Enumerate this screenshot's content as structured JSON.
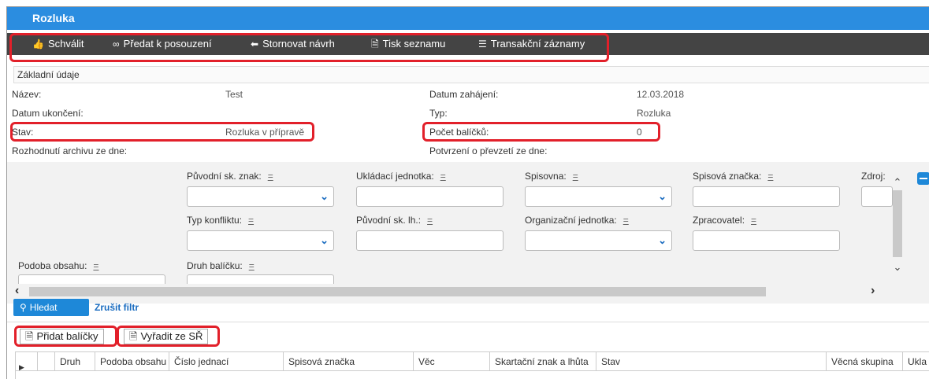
{
  "window": {
    "title": "Rozluka"
  },
  "toolbar": {
    "approve": "Schválit",
    "submit_review": "Předat k posouzení",
    "cancel_proposal": "Stornovat návrh",
    "print_list": "Tisk seznamu",
    "transactions": "Transakční záznamy"
  },
  "section": {
    "title": "Základní údaje"
  },
  "details": {
    "name_label": "Název:",
    "name_value": "Test",
    "start_label": "Datum zahájení:",
    "start_value": "12.03.2018",
    "end_label": "Datum ukončení:",
    "end_value": "",
    "type_label": "Typ:",
    "type_value": "Rozluka",
    "status_label": "Stav:",
    "status_value": "Rozluka v přípravě",
    "count_label": "Počet balíčků:",
    "count_value": "0",
    "decision_label": "Rozhodnutí archivu ze dne:",
    "handover_label": "Potvrzení o převzetí ze dne:"
  },
  "filters": {
    "eq": "=",
    "orig_mark": "Původní sk. znak:",
    "storage_unit": "Ukládací jednotka:",
    "registry": "Spisovna:",
    "file_mark": "Spisová značka:",
    "source": "Zdroj:",
    "conflict_type": "Typ konfliktu:",
    "orig_deadline": "Původní sk. lh.:",
    "org_unit": "Organizační jednotka:",
    "processor": "Zpracovatel:",
    "content_form": "Podoba obsahu:",
    "package_kind": "Druh balíčku:"
  },
  "actions": {
    "search": "Hledat",
    "clear_filter": "Zrušit filtr",
    "add_packages": "Přidat balíčky",
    "remove_from_sr": "Vyřadit ze SŘ"
  },
  "table": {
    "columns": [
      "Druh",
      "Podoba obsahu",
      "Číslo jednací",
      "Spisová značka",
      "Věc",
      "Skartační znak a lhůta",
      "Stav",
      "Věcná skupina",
      "Ukla"
    ]
  },
  "colors": {
    "titlebar": "#2b8de0",
    "toolbar": "#444444",
    "highlight": "#e2202a",
    "accent": "#1e88d8"
  }
}
